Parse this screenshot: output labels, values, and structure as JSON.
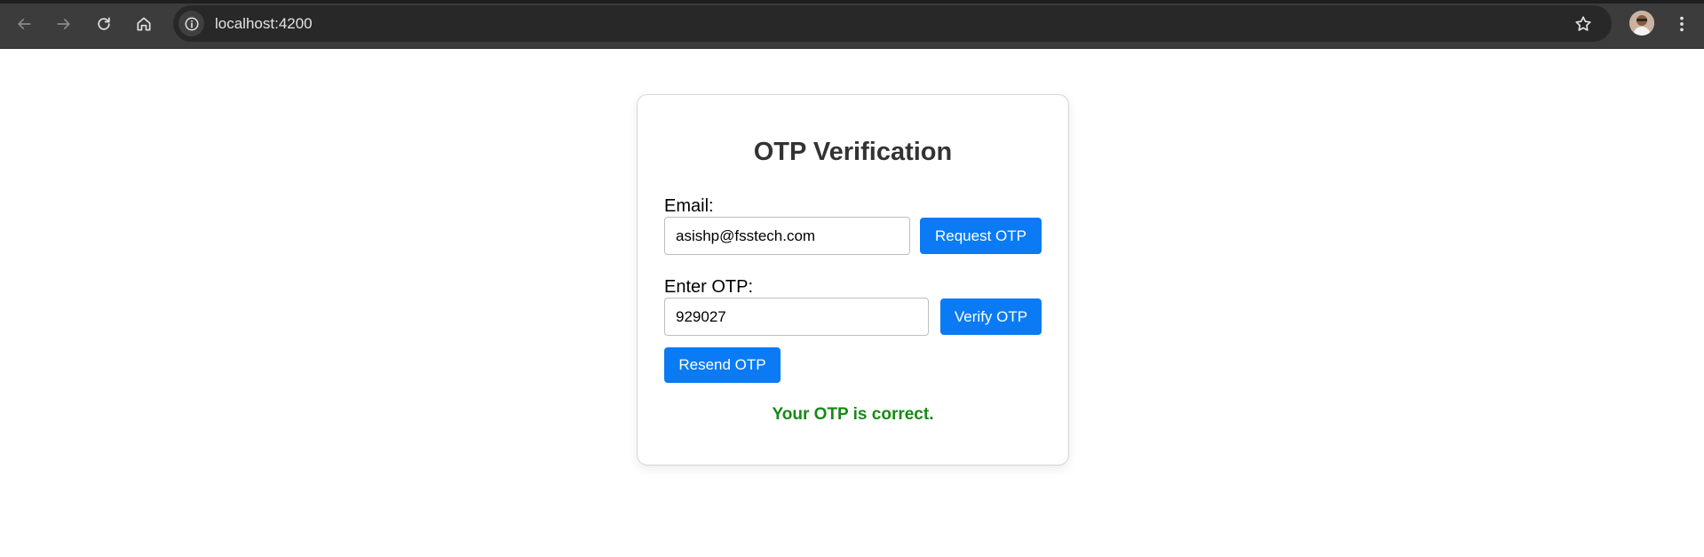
{
  "browser": {
    "url": "localhost:4200"
  },
  "form": {
    "title": "OTP Verification",
    "email_label": "Email:",
    "email_value": "asishp@fsstech.com",
    "request_otp_label": "Request OTP",
    "otp_label": "Enter OTP:",
    "otp_value": "929027",
    "verify_otp_label": "Verify OTP",
    "resend_otp_label": "Resend OTP",
    "status_message": "Your OTP is correct."
  },
  "colors": {
    "primary_button": "#0a7bf5",
    "success_text": "#168a16",
    "title_text": "#333333"
  },
  "icons": {
    "back": "arrow-left-icon",
    "forward": "arrow-right-icon",
    "reload": "reload-icon",
    "home": "home-icon",
    "site_info": "info-icon",
    "bookmark": "star-icon",
    "profile": "avatar",
    "menu": "kebab-menu-icon"
  }
}
